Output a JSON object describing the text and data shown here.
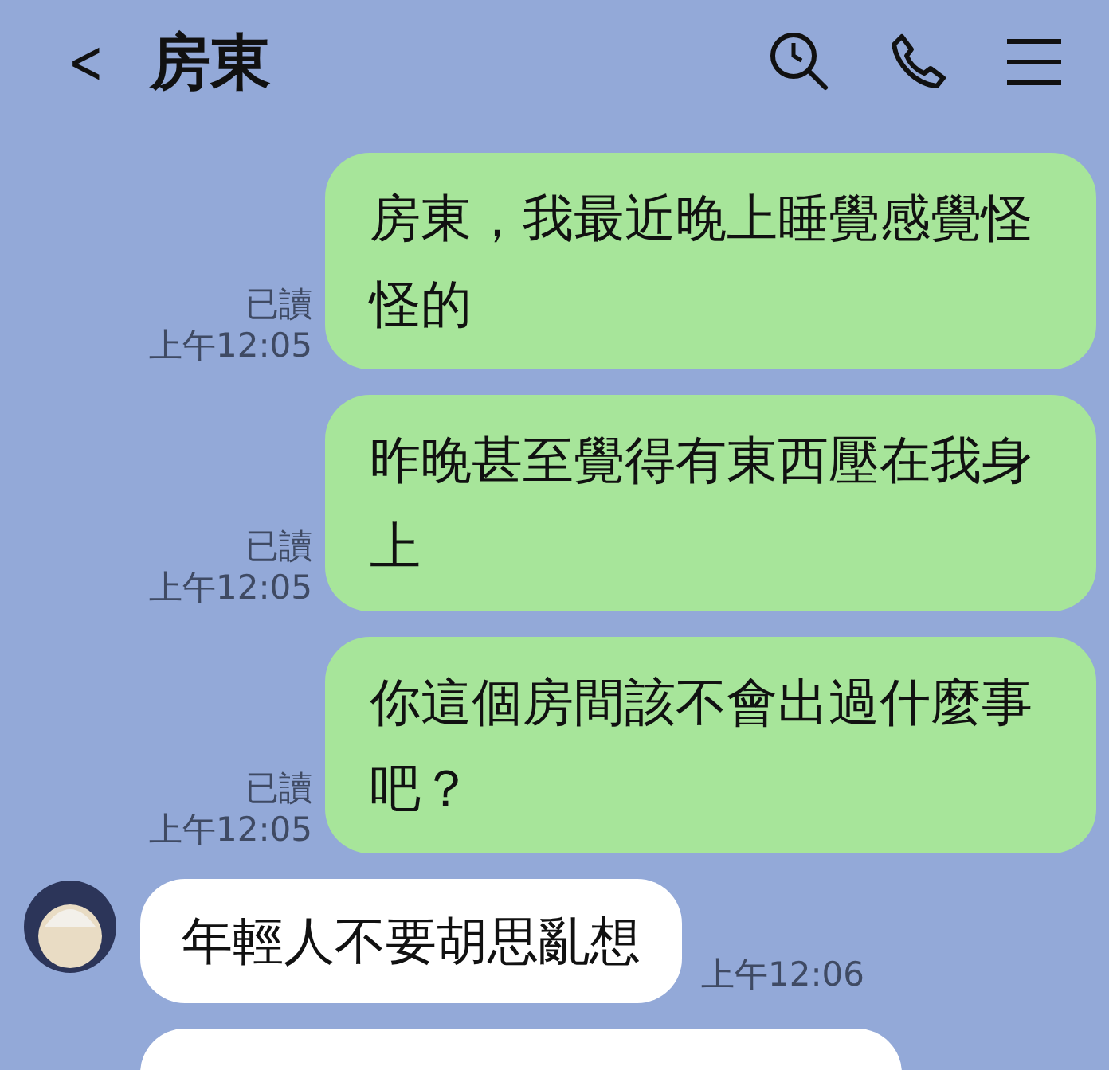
{
  "header": {
    "back": "<",
    "title": "房東"
  },
  "messages": [
    {
      "kind": "sent",
      "text": "房東，我最近晚上睡覺感覺怪怪的",
      "read": "已讀",
      "time": "上午12:05"
    },
    {
      "kind": "sent",
      "text": "昨晚甚至覺得有東西壓在我身上",
      "read": "已讀",
      "time": "上午12:05"
    },
    {
      "kind": "sent",
      "text": "你這個房間該不會出過什麼事吧？",
      "read": "已讀",
      "time": "上午12:05"
    },
    {
      "kind": "received",
      "text": "年輕人不要胡思亂想",
      "time": "上午12:06"
    },
    {
      "kind": "received_cut"
    }
  ]
}
